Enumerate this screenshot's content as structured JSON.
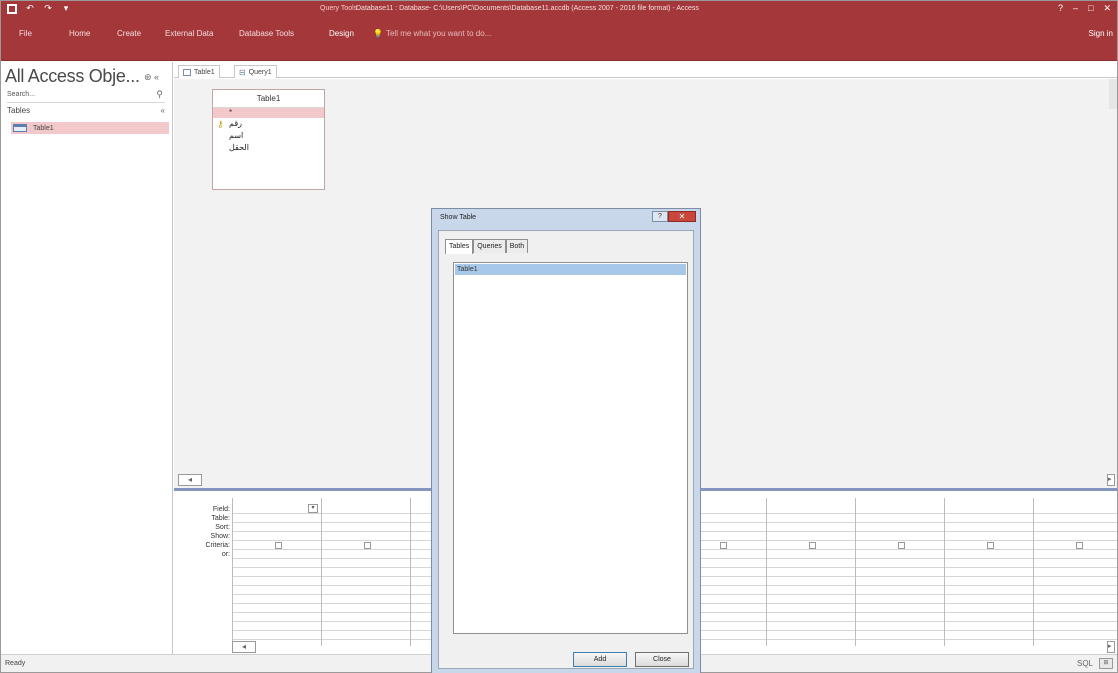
{
  "titlebar": {
    "context_tab": "Query Tools",
    "title": "Database11 : Database- C:\\Users\\PC\\Documents\\Database11.accdb (Access 2007 - 2016 file format) - Access",
    "quick_access": [
      "save-icon",
      "undo-icon",
      "redo-icon",
      "customize-icon"
    ],
    "window_controls": [
      "?",
      "–",
      "□",
      "✕"
    ]
  },
  "ribbon": {
    "tabs": [
      "File",
      "Home",
      "Create",
      "External Data",
      "Database Tools",
      "Design"
    ],
    "active_tab": "Design",
    "tell_me": "Tell me what you want to do...",
    "sign_in": "Sign in"
  },
  "nav": {
    "title": "All Access Obje...",
    "title_icons": "⊛ «",
    "search_placeholder": "Search...",
    "group": "Tables",
    "items": [
      "Table1"
    ]
  },
  "doc_tabs": [
    "Table1",
    "Query1"
  ],
  "field_list": {
    "title": "Table1",
    "star": "*",
    "fields": [
      "رقم",
      "اسم",
      "الحقل"
    ]
  },
  "grid": {
    "row_labels": [
      "Field:",
      "Table:",
      "Sort:",
      "Show:",
      "Criteria:",
      "or:"
    ]
  },
  "dialog": {
    "title": "Show Table",
    "help": "?",
    "close": "✕",
    "tabs": [
      "Tables",
      "Queries",
      "Both"
    ],
    "items": [
      "Table1"
    ],
    "add_label": "Add",
    "close_label": "Close"
  },
  "status": {
    "text": "Ready",
    "views": [
      "SQL",
      "⊞"
    ]
  },
  "colors": {
    "accent": "#a4373a",
    "selection": "#f2c8ca",
    "dialog_frame": "#c8d7ea"
  }
}
